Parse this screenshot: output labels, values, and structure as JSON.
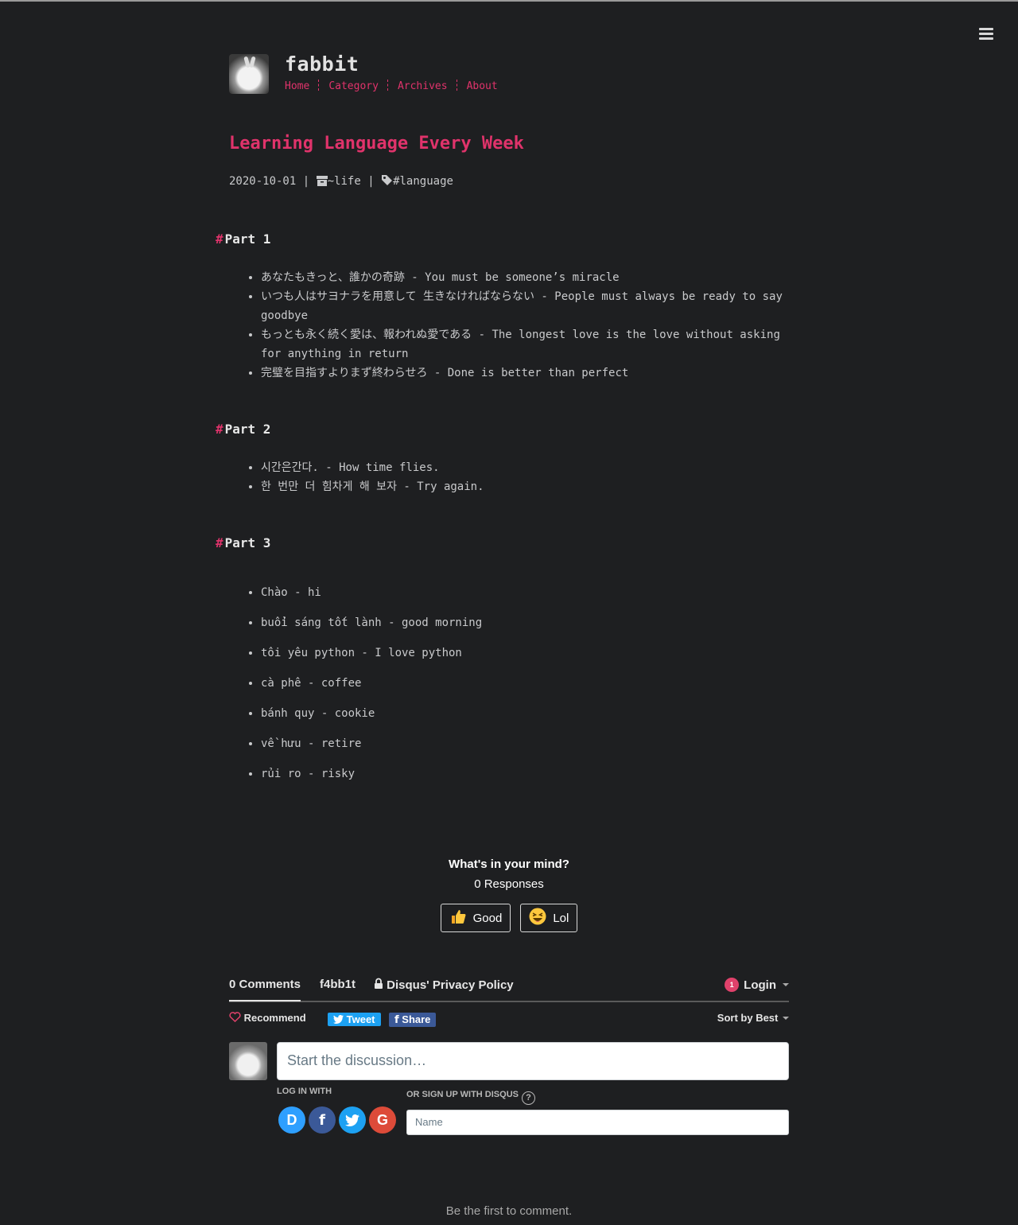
{
  "site": {
    "title": "fabbit",
    "nav": [
      "Home",
      "Category",
      "Archives",
      "About"
    ],
    "menu_icon": "hamburger-icon"
  },
  "post": {
    "title": "Learning Language Every Week",
    "date": "2020-10-01",
    "sep": "|",
    "category": "~life",
    "tag": "#language"
  },
  "sections": [
    {
      "heading": "Part 1",
      "items": [
        "あなたもきっと、誰かの奇跡 - You must be someone’s miracle",
        "いつも人はサヨナラを用意して 生きなければならない - People must always be ready to say goodbye",
        "もっとも永く続く愛は、報われぬ愛である - The longest love is the love without asking for anything in return",
        "完璧を目指すよりまず終わらせろ - Done is better than perfect"
      ]
    },
    {
      "heading": "Part 2",
      "items": [
        "시간은간다. - How time flies.",
        "한 번만 더 힘차게 해 보자 - Try again."
      ]
    },
    {
      "heading": "Part 3",
      "items": [
        "Chào - hi",
        "buổi sáng tốt lành - good morning",
        "tôi yêu python - I love python",
        "cà phê - coffee",
        "bánh quy - cookie",
        "về hưu - retire",
        "rủi ro - risky"
      ]
    }
  ],
  "reactions": {
    "question": "What's in your mind?",
    "count": "0 Responses",
    "buttons": [
      "Good",
      "Lol"
    ]
  },
  "disqus": {
    "comments_tab": "0 Comments",
    "site_tab": "f4bb1t",
    "privacy": "Disqus' Privacy Policy",
    "login_badge": "1",
    "login": "Login",
    "recommend": "Recommend",
    "tweet": "Tweet",
    "share": "Share",
    "sort": "Sort by Best",
    "placeholder": "Start the discussion…",
    "login_with": "LOG IN WITH",
    "signup_with": "OR SIGN UP WITH DISQUS",
    "name_placeholder": "Name",
    "social_letters": [
      "D",
      "f",
      "G"
    ],
    "first_comment": "Be the first to comment.",
    "colors": {
      "disqus": "#2e9fff",
      "facebook": "#3b5998",
      "twitter": "#1da1f2",
      "google": "#dd4b39"
    }
  },
  "colors": {
    "accent": "#e0336b",
    "background": "#1e1f21",
    "text": "#c9cacc"
  }
}
